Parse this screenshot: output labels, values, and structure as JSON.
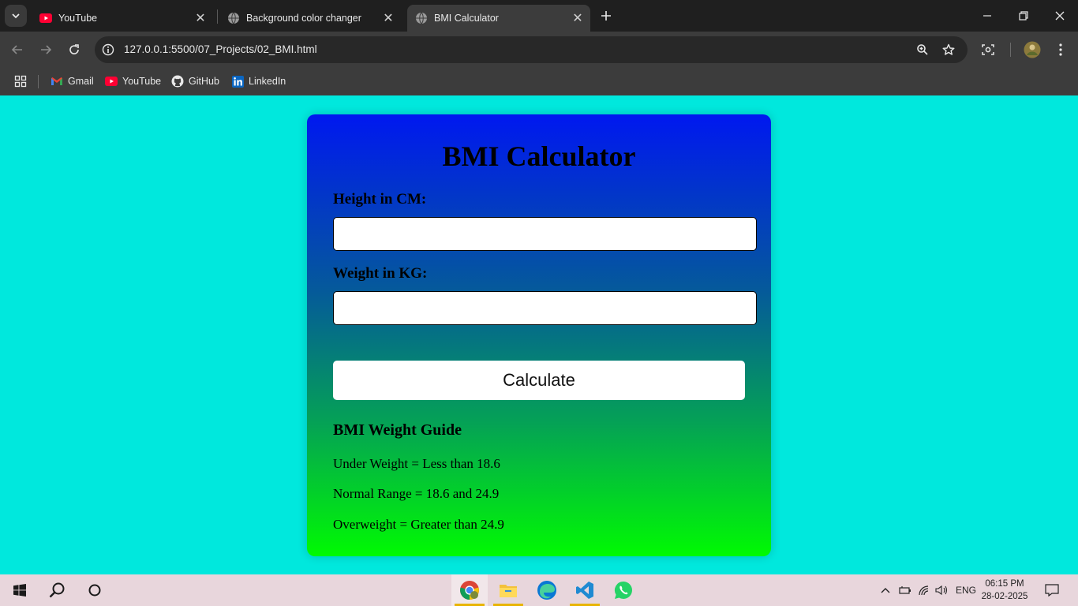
{
  "browser": {
    "tabs": [
      {
        "title": "YouTube",
        "favicon": "youtube-icon",
        "active": false
      },
      {
        "title": "Background color changer",
        "favicon": "globe-icon",
        "active": false
      },
      {
        "title": "BMI Calculator",
        "favicon": "globe-icon",
        "active": true
      }
    ],
    "url": "127.0.0.1:5500/07_Projects/02_BMI.html",
    "bookmarks": [
      {
        "label": "Gmail",
        "icon": "gmail-icon"
      },
      {
        "label": "YouTube",
        "icon": "youtube-icon"
      },
      {
        "label": "GitHub",
        "icon": "github-icon"
      },
      {
        "label": "LinkedIn",
        "icon": "linkedin-icon"
      }
    ]
  },
  "page": {
    "title": "BMI Calculator",
    "height_label": "Height in CM:",
    "height_value": "",
    "weight_label": "Weight in KG:",
    "weight_value": "",
    "calculate_label": "Calculate",
    "guide": {
      "title": "BMI Weight Guide",
      "items": [
        "Under Weight = Less than 18.6",
        "Normal Range = 18.6 and 24.9",
        "Overweight = Greater than 24.9"
      ]
    }
  },
  "taskbar": {
    "lang": "ENG",
    "time": "06:15 PM",
    "date": "28-02-2025",
    "apps": [
      "chrome-icon",
      "file-explorer-icon",
      "edge-icon",
      "vscode-icon",
      "whatsapp-icon"
    ]
  },
  "colors": {
    "page_background": "#00e8dd",
    "card_gradient_top": "#0018f0",
    "card_gradient_bottom": "#00fa02"
  }
}
